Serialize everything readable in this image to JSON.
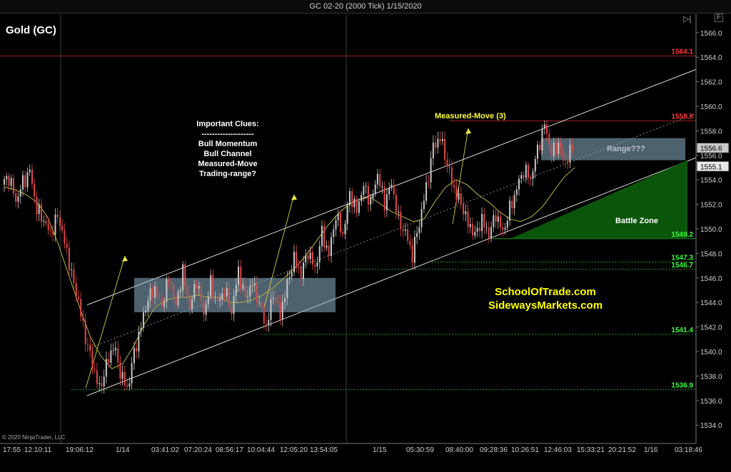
{
  "window": {
    "title": "GC 02-20 (2000 Tick)  1/15/2020"
  },
  "toolbar": {
    "scroll_end_icon": "scroll-to-end-icon",
    "panel_toggle_label": "F"
  },
  "copyright": "© 2020 NinjaTrader, LLC",
  "chart_data": {
    "type": "candlestick",
    "instrument_label": "Gold (GC)",
    "ylim": [
      1532.5,
      1567.5
    ],
    "y_ticks": [
      "1566.0",
      "1564.0",
      "1562.0",
      "1560.0",
      "1558.0",
      "1556.0",
      "1554.0",
      "1552.0",
      "1550.0",
      "1548.0",
      "1546.0",
      "1544.0",
      "1542.0",
      "1540.0",
      "1538.0",
      "1536.0",
      "1534.0"
    ],
    "x_ticks": [
      "17:55",
      "12:10:11",
      "19:06:12",
      "1/14",
      "03:41:02",
      "07:20:24",
      "08:56:17",
      "10:04:44",
      "12:05:20",
      "13:54:05",
      "1/15",
      "05:30:59",
      "08:40:00",
      "09:28:36",
      "10:26:51",
      "12:46:03",
      "15:33:21",
      "20:21:52",
      "1/16",
      "03:18:46"
    ],
    "grid": false,
    "colors": {
      "up": "#c8c8c8",
      "down": "#e04848",
      "moving_average": "#b8b43a",
      "background": "#000000"
    },
    "horizontal_lines": [
      {
        "price": 1564.1,
        "label": "1564.1",
        "color": "#ff3a3a"
      },
      {
        "price": 1558.8,
        "label": "1558.8",
        "color": "#ff3a3a"
      },
      {
        "price": 1549.2,
        "label": "1549.2",
        "color": "#3aff3a"
      },
      {
        "price": 1547.3,
        "label": "1547.3",
        "color": "#3aff3a"
      },
      {
        "price": 1546.7,
        "label": "1546.7",
        "color": "#3aff3a"
      },
      {
        "price": 1541.4,
        "label": "1541.4",
        "color": "#3aff3a"
      },
      {
        "price": 1536.9,
        "label": "1536.9",
        "color": "#3aff3a"
      }
    ],
    "current_price_flags": [
      {
        "price": 1556.6,
        "label": "1556.6"
      },
      {
        "price": 1555.1,
        "label": "1555.1"
      }
    ],
    "annotations": {
      "clues_title": "Important Clues:",
      "clues_separator": "--------------------",
      "clues": [
        "Bull Momentum",
        "Bull Channel",
        "Measured-Move",
        "Trading-range?"
      ],
      "measured_move": "Measured-Move (3)",
      "range": "Range???",
      "battle_zone": "Battle Zone",
      "site1": "SchoolOfTrade.com",
      "site2": "SidewaysMarkets.com"
    },
    "series": [
      {
        "name": "Price",
        "segments": [
          [
            1553.6,
            1554.2
          ],
          [
            1554.2,
            1552.4
          ],
          [
            1552.4,
            1553.8
          ],
          [
            1553.8,
            1554.6
          ],
          [
            1554.6,
            1551.6
          ],
          [
            1551.6,
            1550.8
          ],
          [
            1550.8,
            1549.6
          ],
          [
            1549.6,
            1551.0
          ],
          [
            1551.0,
            1549.0
          ],
          [
            1549.0,
            1546.4
          ],
          [
            1546.4,
            1544.0
          ],
          [
            1544.0,
            1541.0
          ],
          [
            1541.0,
            1539.0
          ],
          [
            1539.0,
            1537.0
          ],
          [
            1537.0,
            1538.8
          ],
          [
            1538.8,
            1540.4
          ],
          [
            1540.4,
            1538.4
          ],
          [
            1538.4,
            1537.0
          ],
          [
            1537.0,
            1539.8
          ],
          [
            1539.8,
            1542.0
          ],
          [
            1542.0,
            1544.4
          ],
          [
            1544.4,
            1545.2
          ],
          [
            1545.2,
            1543.6
          ],
          [
            1543.6,
            1546.0
          ],
          [
            1546.0,
            1543.8
          ],
          [
            1543.8,
            1546.6
          ],
          [
            1546.6,
            1543.4
          ],
          [
            1543.4,
            1545.8
          ],
          [
            1545.8,
            1543.2
          ],
          [
            1543.2,
            1545.6
          ],
          [
            1545.6,
            1543.8
          ],
          [
            1543.8,
            1545.0
          ],
          [
            1545.0,
            1543.4
          ],
          [
            1543.4,
            1546.6
          ],
          [
            1546.6,
            1544.2
          ],
          [
            1544.2,
            1545.6
          ],
          [
            1545.6,
            1544.0
          ],
          [
            1544.0,
            1542.0
          ],
          [
            1542.0,
            1544.6
          ],
          [
            1544.6,
            1543.0
          ],
          [
            1543.0,
            1545.6
          ],
          [
            1545.6,
            1547.6
          ],
          [
            1547.6,
            1546.2
          ],
          [
            1546.2,
            1548.2
          ],
          [
            1548.2,
            1546.8
          ],
          [
            1546.8,
            1549.6
          ],
          [
            1549.6,
            1547.8
          ],
          [
            1547.8,
            1551.2
          ],
          [
            1551.2,
            1549.6
          ],
          [
            1549.6,
            1552.8
          ],
          [
            1552.8,
            1551.4
          ],
          [
            1551.4,
            1553.6
          ],
          [
            1553.6,
            1552.2
          ],
          [
            1552.2,
            1554.4
          ],
          [
            1554.4,
            1552.0
          ],
          [
            1552.0,
            1553.8
          ],
          [
            1553.8,
            1550.8
          ],
          [
            1550.8,
            1549.6
          ],
          [
            1549.6,
            1547.8
          ],
          [
            1547.8,
            1550.6
          ],
          [
            1550.6,
            1553.4
          ],
          [
            1553.4,
            1556.6
          ],
          [
            1556.6,
            1557.4
          ],
          [
            1557.4,
            1555.4
          ],
          [
            1555.4,
            1553.2
          ],
          [
            1553.2,
            1552.0
          ],
          [
            1552.0,
            1550.4
          ],
          [
            1550.4,
            1549.6
          ],
          [
            1549.6,
            1550.8
          ],
          [
            1550.8,
            1549.4
          ],
          [
            1549.4,
            1551.2
          ],
          [
            1551.2,
            1549.8
          ],
          [
            1549.8,
            1551.6
          ],
          [
            1551.6,
            1553.2
          ],
          [
            1553.2,
            1554.8
          ],
          [
            1554.8,
            1554.2
          ],
          [
            1554.2,
            1556.4
          ],
          [
            1556.4,
            1558.4
          ],
          [
            1558.4,
            1556.2
          ],
          [
            1556.2,
            1557.0
          ],
          [
            1557.0,
            1555.4
          ],
          [
            1555.4,
            1556.6
          ]
        ]
      },
      {
        "name": "Moving Average",
        "values": [
          1553.4,
          1553.2,
          1552.8,
          1552.2,
          1551.0,
          1548.8,
          1546.2,
          1543.6,
          1541.2,
          1539.6,
          1538.6,
          1539.0,
          1540.4,
          1542.2,
          1543.6,
          1544.2,
          1544.4,
          1544.4,
          1544.6,
          1544.4,
          1544.4,
          1544.0,
          1544.0,
          1544.2,
          1544.6,
          1545.2,
          1546.0,
          1546.8,
          1547.8,
          1549.0,
          1550.2,
          1551.2,
          1552.0,
          1552.4,
          1552.6,
          1552.0,
          1551.4,
          1551.0,
          1550.6,
          1550.8,
          1552.2,
          1553.4,
          1554.0,
          1553.6,
          1552.8,
          1552.2,
          1551.4,
          1550.8,
          1550.6,
          1551.0,
          1551.8,
          1553.0,
          1554.2,
          1555.0
        ]
      }
    ]
  }
}
